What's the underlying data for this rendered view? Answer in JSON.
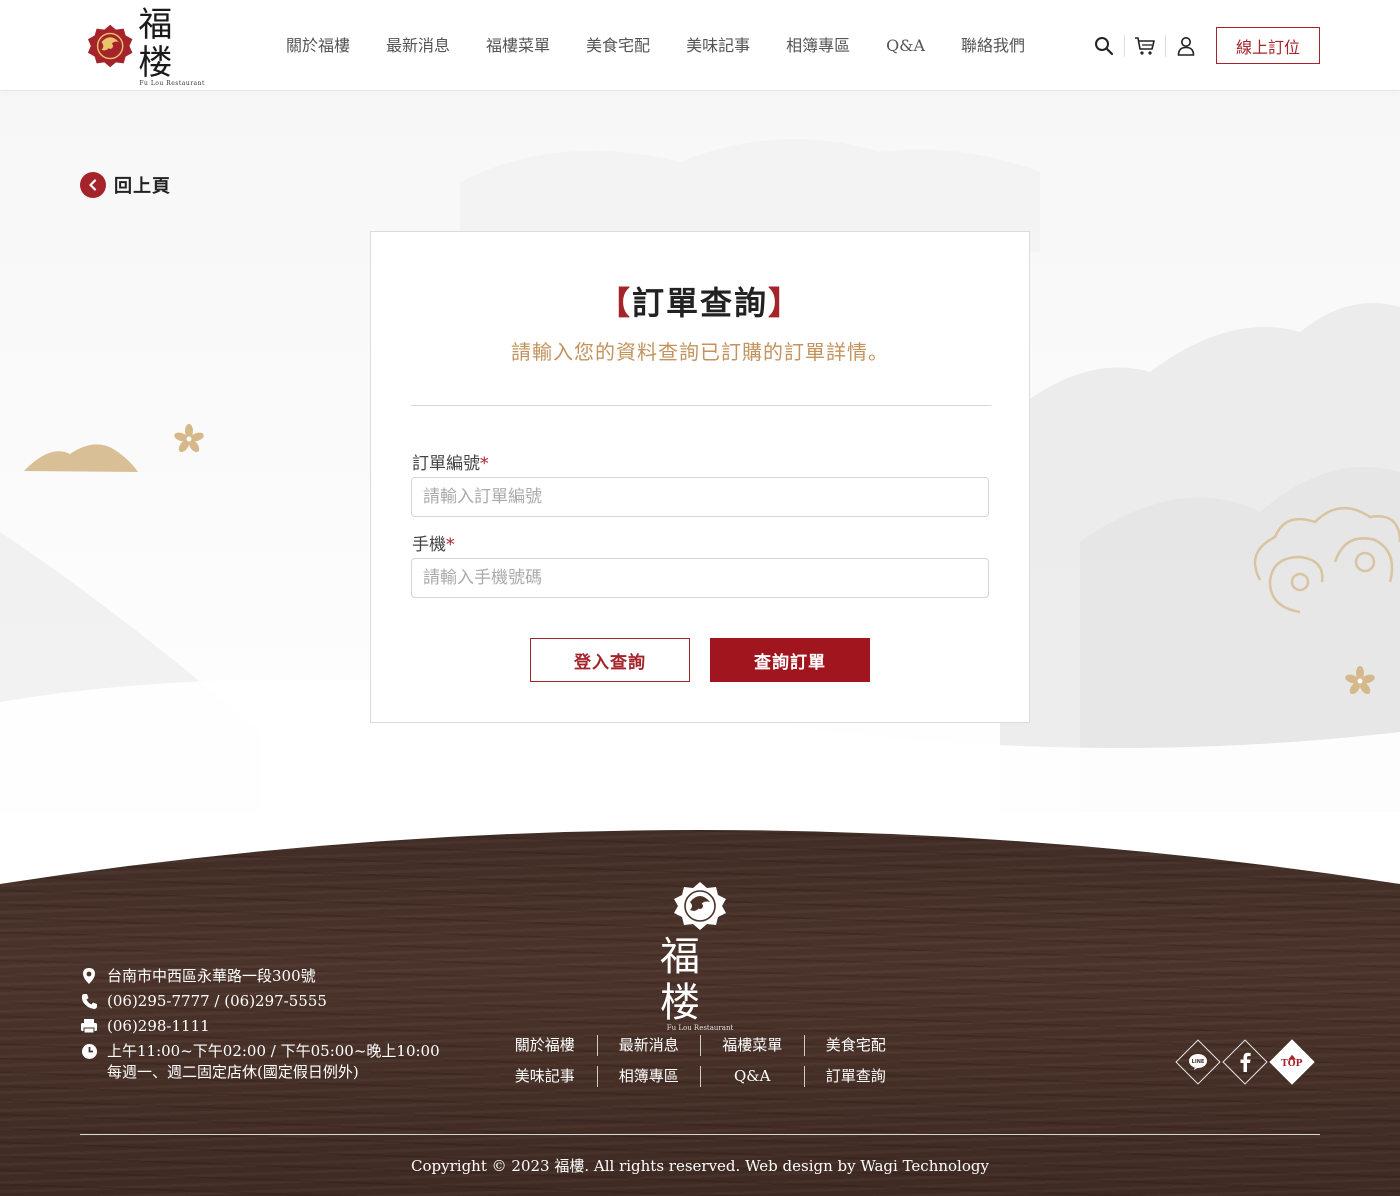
{
  "header": {
    "logo_cn": "福楼",
    "logo_en": "Fu Lou Restaurant",
    "nav": [
      "關於福樓",
      "最新消息",
      "福樓菜單",
      "美食宅配",
      "美味記事",
      "相簿專區",
      "Q&A",
      "聯絡我們"
    ],
    "icons": [
      "search-icon",
      "cart-icon",
      "user-icon"
    ],
    "reserve_label": "線上訂位"
  },
  "back": {
    "label": "回上頁",
    "icon": "chevron-left-icon"
  },
  "form": {
    "bracket_left": "【",
    "title": "訂單查詢",
    "bracket_right": "】",
    "subtitle": "請輸入您的資料查詢已訂購的訂單詳情。",
    "order_label": "訂單編號",
    "order_placeholder": "請輸入訂單編號",
    "order_value": "",
    "phone_label": "手機",
    "phone_placeholder": "請輸入手機號碼",
    "phone_value": "",
    "required_mark": "*",
    "login_button": "登入查詢",
    "query_button": "查詢訂單"
  },
  "footer": {
    "logo_cn": "福楼",
    "logo_en": "Fu Lou Restaurant",
    "address": "台南市中西區永華路一段300號",
    "phone": "(06)295-7777 / (06)297-5555",
    "fax": "(06)298-1111",
    "hours_1": "上午11:00~下午02:00 / 下午05:00~晚上10:00",
    "hours_2": "每週一、週二固定店休(國定假日例外)",
    "links_row1": [
      "關於福樓",
      "最新消息",
      "福樓菜單",
      "美食宅配"
    ],
    "links_row2": [
      "美味記事",
      "相簿專區",
      "Q&A",
      "訂單查詢"
    ],
    "social": [
      "line-icon",
      "facebook-icon"
    ],
    "top_label": "TOP",
    "copyright": "Copyright © 2023 福樓. All rights reserved. Web design by Wagi Technology"
  },
  "colors": {
    "brand_red": "#a5232a",
    "button_red": "#a0151e",
    "gold": "#c3935e",
    "footer_wood": "#3e2a22"
  }
}
